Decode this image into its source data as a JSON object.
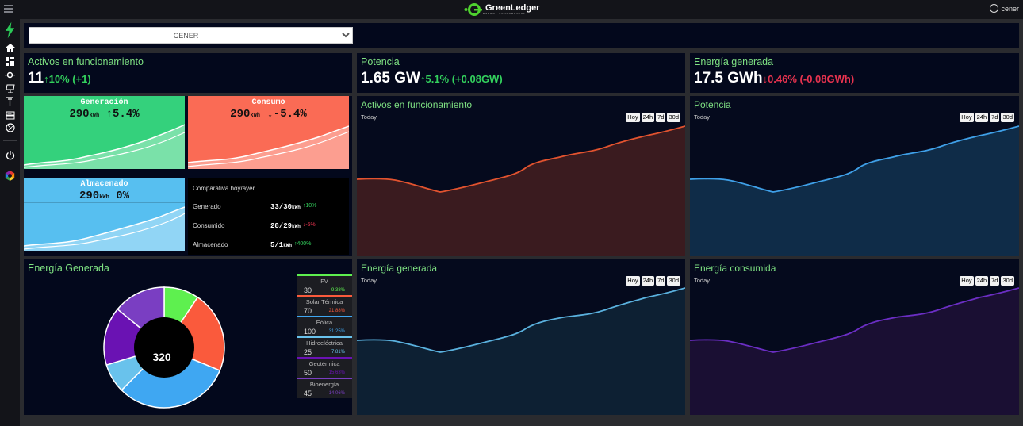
{
  "header": {
    "logo_text": "GreenLedger",
    "logo_sub": "ENERGY FUNDAMENTAL",
    "user": "cener"
  },
  "filter": {
    "selected": "CENER"
  },
  "kpis": [
    {
      "title": "Activos en funcionamiento",
      "value": "11",
      "delta": "↑10% (+1)",
      "trend": "up"
    },
    {
      "title": "Potencia",
      "value": "1.65 GW",
      "delta": "↑5.1% (+0.08GW)",
      "trend": "up"
    },
    {
      "title": "Energía generada",
      "value": "17.5 GWh",
      "delta": "↓0.46% (-0.08GWh)",
      "trend": "down"
    }
  ],
  "minis": {
    "generacion": {
      "title": "Generación",
      "value": "290",
      "unit": "kWh",
      "delta": "↑5.4%",
      "color": "#34d17c"
    },
    "consumo": {
      "title": "Consumo",
      "value": "290",
      "unit": "kWh",
      "delta": "↓-5.4%",
      "color": "#fa6b55"
    },
    "almacenado": {
      "title": "Almacenado",
      "value": "290",
      "unit": "kWh",
      "delta": "0%",
      "color": "#57bff0"
    }
  },
  "comparativa": {
    "title": "Comparativa hoy/ayer",
    "rows": [
      {
        "label": "Generado",
        "value": "33/30",
        "unit": "kWh",
        "delta": "↑10%",
        "trend": "up"
      },
      {
        "label": "Consumido",
        "value": "28/29",
        "unit": "kWh",
        "delta": "↓-5%",
        "trend": "down"
      },
      {
        "label": "Almacenado",
        "value": "5/1",
        "unit": "kWh",
        "delta": "↑400%",
        "trend": "up"
      }
    ]
  },
  "range_buttons": [
    "Hoy",
    "24h",
    "7d",
    "30d"
  ],
  "charts": [
    {
      "title": "Activos en funcionamiento",
      "subtitle": "Today",
      "line": "#e2532f",
      "fill": "#3a1b1f"
    },
    {
      "title": "Potencia",
      "subtitle": "Today",
      "line": "#3fa0e8",
      "fill": "#0f2c48"
    },
    {
      "title": "Energía generada",
      "subtitle": "Today",
      "line": "#5ab1de",
      "fill": "#0d2033"
    },
    {
      "title": "Energía consumida",
      "subtitle": "Today",
      "line": "#6b2ec4",
      "fill": "#1a0f33"
    }
  ],
  "donut": {
    "title": "Energía Generada",
    "total": "320",
    "segments": [
      {
        "name": "FV",
        "value": "30",
        "pct": "9.38%",
        "color": "#5ef04f"
      },
      {
        "name": "Solar Térmica",
        "value": "70",
        "pct": "21.88%",
        "color": "#fa5a3c"
      },
      {
        "name": "Eólica",
        "value": "100",
        "pct": "31.25%",
        "color": "#3fa7f2"
      },
      {
        "name": "Hidroeléctrica",
        "value": "25",
        "pct": "7.81%",
        "color": "#69c2ec"
      },
      {
        "name": "Geotérmica",
        "value": "50",
        "pct": "15.63%",
        "color": "#6a12b3"
      },
      {
        "name": "Bioenergía",
        "value": "45",
        "pct": "14.06%",
        "color": "#7a3ec2"
      }
    ]
  },
  "chart_data": {
    "type": "pie",
    "categories": [
      "FV",
      "Solar Térmica",
      "Eólica",
      "Hidroeléctrica",
      "Geotérmica",
      "Bioenergía"
    ],
    "values": [
      30,
      70,
      100,
      25,
      50,
      45
    ],
    "title": "Energía Generada"
  }
}
